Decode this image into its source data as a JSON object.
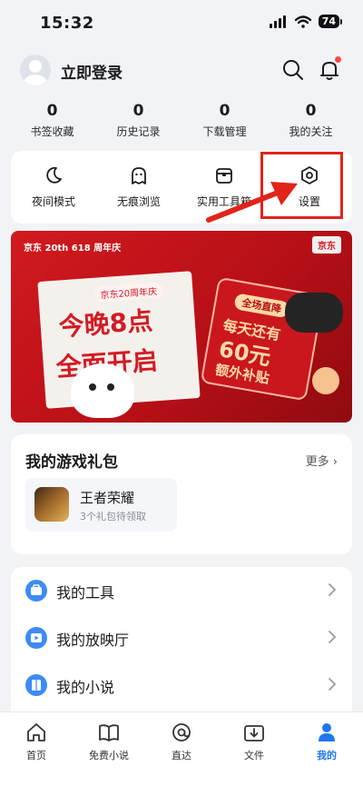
{
  "status_bar": {
    "time": "15:32",
    "battery": "74"
  },
  "header": {
    "login_label": "立即登录"
  },
  "stats": [
    {
      "count": "0",
      "label": "书签收藏"
    },
    {
      "count": "0",
      "label": "历史记录"
    },
    {
      "count": "0",
      "label": "下载管理"
    },
    {
      "count": "0",
      "label": "我的关注"
    }
  ],
  "quick_tools": [
    {
      "label": "夜间模式",
      "icon": "moon-icon"
    },
    {
      "label": "无痕浏览",
      "icon": "ghost-icon"
    },
    {
      "label": "实用工具箱",
      "icon": "toolbox-icon"
    },
    {
      "label": "设置",
      "icon": "settings-hexagon-icon"
    }
  ],
  "banner": {
    "brand_tag": "京东 20th 618 周年庆",
    "paper_head": "京东20周年庆",
    "headline_1": "今晚8点",
    "headline_2": "全面开启",
    "tag_pill": "全场直降",
    "tag_line_1": "每天还有",
    "tag_line_2": "60元",
    "tag_line_3": "额外补贴",
    "mini_logo": "京东"
  },
  "games": {
    "title": "我的游戏礼包",
    "more": "更多 ›",
    "items": [
      {
        "name": "王者荣耀",
        "subtitle": "3个礼包待领取"
      }
    ]
  },
  "menu": [
    {
      "label": "我的工具",
      "icon": "toolbox-icon"
    },
    {
      "label": "我的放映厅",
      "icon": "play-icon"
    },
    {
      "label": "我的小说",
      "icon": "book-icon"
    }
  ],
  "tabbar": [
    {
      "label": "首页",
      "icon": "home-icon"
    },
    {
      "label": "免费小说",
      "icon": "book-icon"
    },
    {
      "label": "直达",
      "icon": "at-icon"
    },
    {
      "label": "文件",
      "icon": "download-folder-icon"
    },
    {
      "label": "我的",
      "icon": "profile-icon",
      "active": true
    }
  ],
  "colors": {
    "accent": "#1e78f0",
    "highlight": "#e2231a",
    "banner": "#c9171d"
  }
}
